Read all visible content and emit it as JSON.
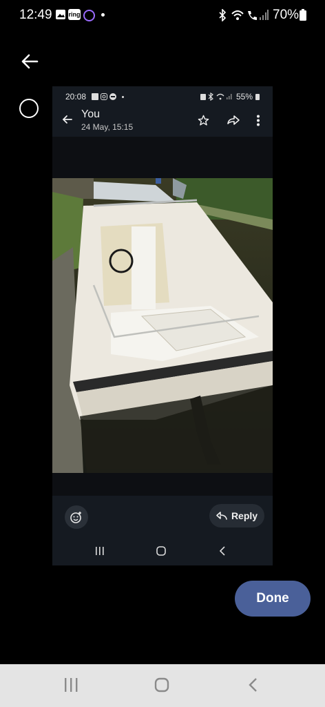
{
  "status_bar": {
    "time": "12:49",
    "battery": "70%",
    "left_icons": [
      "gallery-icon",
      "ring-app-icon",
      "circle-app-icon",
      "dot-icon"
    ],
    "right_icons": [
      "bluetooth-icon",
      "wifi-icon",
      "call-icon",
      "signal-icon",
      "battery-icon"
    ]
  },
  "inner_screenshot": {
    "status": {
      "time": "20:08",
      "battery": "55%"
    },
    "header": {
      "sender": "You",
      "date": "24 May, 15:15"
    },
    "reply_label": "Reply"
  },
  "done_label": "Done",
  "ring_label": "ring",
  "colors": {
    "accent": "#4a6099",
    "inner_bg": "#151a21"
  }
}
